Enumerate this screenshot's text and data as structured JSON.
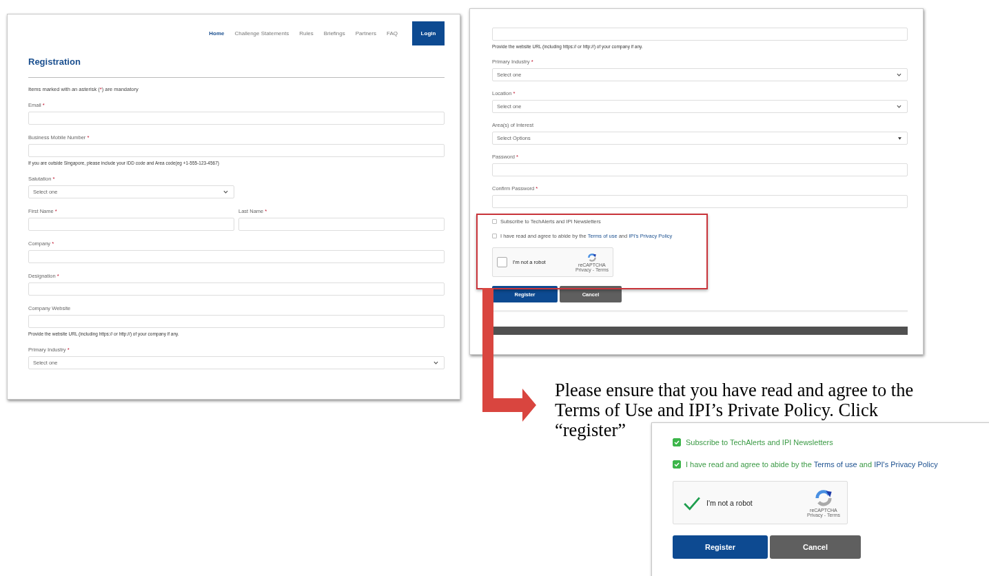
{
  "registration_page": {
    "nav": [
      {
        "label": "Home",
        "selected": true
      },
      {
        "label": "Challenge Statements",
        "selected": false
      },
      {
        "label": "Rules",
        "selected": false
      },
      {
        "label": "Briefings",
        "selected": false
      },
      {
        "label": "Partners",
        "selected": false
      },
      {
        "label": "FAQ",
        "selected": false
      }
    ],
    "login_button": "Login",
    "title": "Registration",
    "mandatory_note": {
      "before": "Items marked with an asterisk (",
      "mark": "*",
      "after": ") are mandatory"
    },
    "fields": [
      {
        "kind": "text",
        "label": "Email",
        "required_mark": "*"
      },
      {
        "kind": "text",
        "label": "Business Mobile Number",
        "required_mark": "*",
        "hint": "If you are outside Singapore, please include your IDD code and Area code(eg +1-555-123-4567)"
      },
      {
        "kind": "select",
        "label": "Salutation",
        "required_mark": "*",
        "placeholder": "Select one",
        "narrow": true
      },
      {
        "kind": "pair",
        "fields": [
          {
            "kind": "text",
            "label": "First Name",
            "required_mark": "*"
          },
          {
            "kind": "text",
            "label": "Last Name",
            "required_mark": "*"
          }
        ]
      },
      {
        "kind": "text",
        "label": "Company",
        "required_mark": "*"
      },
      {
        "kind": "text",
        "label": "Designation",
        "required_mark": "*"
      },
      {
        "kind": "text",
        "label": "Company Website",
        "hint": "Provide the website URL (including https:// or http://) of your company if any."
      },
      {
        "kind": "select",
        "label": "Primary Industry",
        "required_mark": "*",
        "placeholder": "Select one"
      }
    ]
  },
  "registration_page_bottom": {
    "fields": [
      {
        "kind": "text",
        "hint": "Provide the website URL (including https:// or http://) of your company if any."
      },
      {
        "kind": "select",
        "label": "Primary Industry",
        "required_mark": "*",
        "placeholder": "Select one"
      },
      {
        "kind": "select",
        "label": "Location",
        "required_mark": "*",
        "placeholder": "Select one"
      },
      {
        "kind": "multiselect",
        "label": "Area(s) of Interest",
        "placeholder": "Select Options"
      },
      {
        "kind": "text",
        "label": "Password",
        "required_mark": "*"
      },
      {
        "kind": "text",
        "label": "Confirm Password",
        "required_mark": "*"
      }
    ],
    "checkboxes": [
      {
        "checked": false,
        "text": "Subscribe to TechAlerts and IPI Newsletters"
      },
      {
        "checked": false,
        "text": "I have read and agree to abide by the ",
        "first_link": "Terms of use",
        "joiner": " and ",
        "second_link": "IPI's Privacy Policy"
      }
    ],
    "captcha": {
      "checked": false,
      "label": "I'm not a robot",
      "brand": "reCAPTCHA",
      "legal": "Privacy - Terms"
    },
    "buttons": [
      {
        "label": "Register",
        "kind": "primary"
      },
      {
        "label": "Cancel",
        "kind": "secondary"
      }
    ]
  },
  "caption": [
    "Please ensure that you have read and agree to the",
    "Terms of Use and IPI’s Private Policy. Click",
    "“register”"
  ],
  "completed_section": {
    "checkboxes": [
      {
        "checked": true,
        "text": "Subscribe to TechAlerts and IPI Newsletters"
      },
      {
        "checked": true,
        "text": "I have read and agree to abide by the ",
        "first_link": "Terms of use",
        "joiner": " and ",
        "second_link": "IPI's Privacy Policy"
      }
    ],
    "captcha": {
      "checked": true,
      "label": "I'm not a robot",
      "brand": "reCAPTCHA",
      "legal": "Privacy - Terms"
    },
    "buttons": [
      {
        "label": "Register",
        "kind": "primary"
      },
      {
        "label": "Cancel",
        "kind": "secondary"
      }
    ]
  }
}
